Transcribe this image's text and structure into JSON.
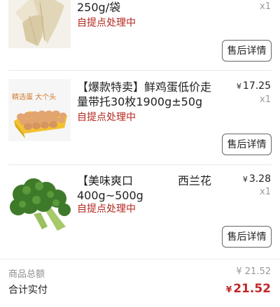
{
  "colors": {
    "status_red": "#b3261e",
    "total_red": "#c0282b",
    "muted": "#9a9a9a"
  },
  "items": [
    {
      "name_lines": [
        "250g/袋"
      ],
      "status": "自提点处理中",
      "qty": "x1",
      "after_sale_label": "售后详情",
      "image_icon": "bamboo-shoot-product-image"
    },
    {
      "name_lines": [
        "【爆款特卖】鲜鸡蛋低价走",
        "量带托30枚1900g±50g"
      ],
      "price_symbol": "¥",
      "price": "17.25",
      "status": "自提点处理中",
      "qty": "x1",
      "after_sale_label": "售后详情",
      "image_caption": "精选蛋 大个头",
      "image_icon": "egg-tray-product-image"
    },
    {
      "name_lines": [
        "【美味爽口　　　　西兰花",
        "400g~500g"
      ],
      "price_symbol": "¥",
      "price": "3.28",
      "status": "自提点处理中",
      "qty": "x1",
      "after_sale_label": "售后详情",
      "image_icon": "broccoli-product-image"
    }
  ],
  "summary": {
    "goods_total_label": "商品总额",
    "goods_total_value": "¥ 21.52",
    "paid_label": "合计实付",
    "paid_symbol": "¥",
    "paid_value": "21.52"
  }
}
